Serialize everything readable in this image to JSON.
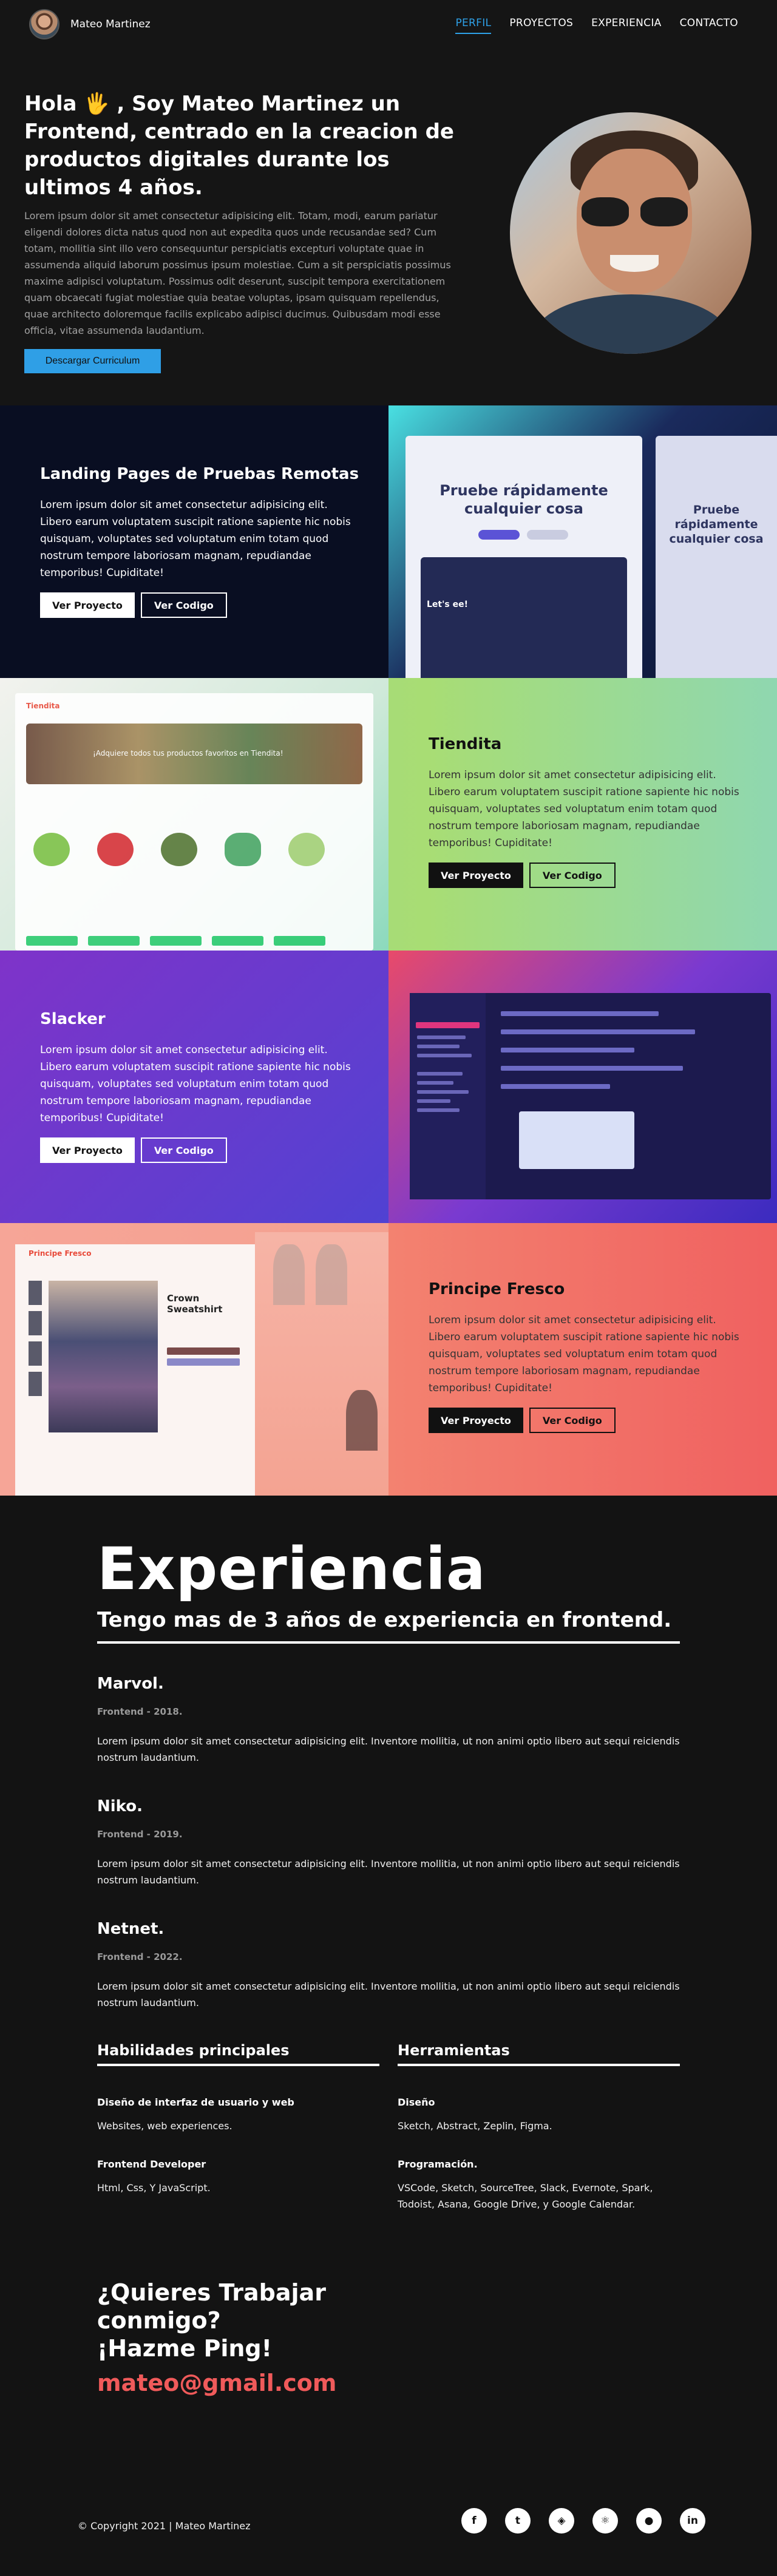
{
  "nav": {
    "brand_name": "Mateo Martinez",
    "links": [
      "PERFIL",
      "PROYECTOS",
      "EXPERIENCIA",
      "CONTACTO"
    ],
    "active": "PERFIL",
    "accent_color": "#2ea1e8"
  },
  "hero": {
    "title": "Hola 🖐 , Soy Mateo Martinez un Frontend, centrado en la creacion de productos digitales durante los ultimos 4 años.",
    "lead": "Lorem ipsum dolor sit amet consectetur adipisicing elit. Totam, modi, earum pariatur eligendi dolores dicta natus quod non aut expedita quos unde recusandae sed? Cum totam, mollitia sint illo vero consequuntur perspiciatis excepturi voluptate quae in assumenda aliquid laborum possimus ipsum molestiae. Cum a sit perspiciatis possimus maxime adipisci voluptatum. Possimus odit deserunt, suscipit tempora exercitationem quam obcaecati fugiat molestiae quia beatae voluptas, ipsam quisquam repellendus, quae architecto doloremque facilis explicabo adipisci ducimus. Quibusdam modi esse officia, vitae assumenda laudantium.",
    "cv_button": "Descargar Curriculum"
  },
  "projects": [
    {
      "title": "Landing Pages de Pruebas Remotas",
      "text": "Lorem ipsum dolor sit amet consectetur adipisicing elit. Libero earum voluptatem suscipit ratione sapiente hic nobis quisquam, voluptates sed voluptatum enim totam quod nostrum tempore laboriosam magnam, repudiandae temporibus! Cupiditate!",
      "btn_project": "Ver Proyecto",
      "btn_code": "Ver Codigo",
      "mock_heading": "Pruebe rápidamente cualquier cosa",
      "mock_sub": "Let's ee!"
    },
    {
      "title": "Tiendita",
      "text": "Lorem ipsum dolor sit amet consectetur adipisicing elit. Libero earum voluptatem suscipit ratione sapiente hic nobis quisquam, voluptates sed voluptatum enim totam quod nostrum tempore laboriosam magnam, repudiandae temporibus! Cupiditate!",
      "btn_project": "Ver Proyecto",
      "btn_code": "Ver Codigo",
      "mock_logo": "Tiendita",
      "mock_banner": "¡Adquiere todos tus productos favoritos en Tiendita!"
    },
    {
      "title": "Slacker",
      "text": "Lorem ipsum dolor sit amet consectetur adipisicing elit. Libero earum voluptatem suscipit ratione sapiente hic nobis quisquam, voluptates sed voluptatum enim totam quod nostrum tempore laboriosam magnam, repudiandae temporibus! Cupiditate!",
      "btn_project": "Ver Proyecto",
      "btn_code": "Ver Codigo"
    },
    {
      "title": "Principe Fresco",
      "text": "Lorem ipsum dolor sit amet consectetur adipisicing elit. Libero earum voluptatem suscipit ratione sapiente hic nobis quisquam, voluptates sed voluptatum enim totam quod nostrum tempore laboriosam magnam, repudiandae temporibus! Cupiditate!",
      "btn_project": "Ver Proyecto",
      "btn_code": "Ver Codigo",
      "mock_logo": "Principe Fresco",
      "mock_product": "Crown Sweatshirt"
    }
  ],
  "experience": {
    "heading": "Experiencia",
    "subheading": "Tengo mas de 3 años de experiencia en frontend.",
    "jobs": [
      {
        "company": "Marvol.",
        "role": "Frontend - 2018.",
        "text": "Lorem ipsum dolor sit amet consectetur adipisicing elit. Inventore mollitia, ut non animi optio libero aut sequi reiciendis nostrum laudantium."
      },
      {
        "company": "Niko.",
        "role": "Frontend - 2019.",
        "text": "Lorem ipsum dolor sit amet consectetur adipisicing elit. Inventore mollitia, ut non animi optio libero aut sequi reiciendis nostrum laudantium."
      },
      {
        "company": "Netnet.",
        "role": "Frontend - 2022.",
        "text": "Lorem ipsum dolor sit amet consectetur adipisicing elit. Inventore mollitia, ut non animi optio libero aut sequi reiciendis nostrum laudantium."
      }
    ],
    "skills": {
      "heading": "Habilidades principales",
      "items": [
        {
          "k": "Diseño de interfaz de usuario y web",
          "v": "Websites, web experiences."
        },
        {
          "k": "Frontend Developer",
          "v": "Html, Css, Y JavaScript."
        }
      ]
    },
    "tools": {
      "heading": "Herramientas",
      "items": [
        {
          "k": "Diseño",
          "v": "Sketch, Abstract, Zeplin, Figma."
        },
        {
          "k": "Programación.",
          "v": "VSCode, Sketch, SourceTree, Slack, Evernote, Spark, Todoist, Asana, Google Drive, y Google Calendar."
        }
      ]
    },
    "cta_line1": "¿Quieres Trabajar",
    "cta_line2": "conmigo?",
    "cta_line3": "¡Hazme Ping!",
    "email": "mateo@gmail.com",
    "email_color": "#f05a5a"
  },
  "footer": {
    "copyright": "© Copyright 2021 | Mateo Martinez",
    "socials": [
      {
        "name": "facebook-icon",
        "glyph": "f"
      },
      {
        "name": "twitter-icon",
        "glyph": "t"
      },
      {
        "name": "codepen-icon",
        "glyph": "◈"
      },
      {
        "name": "react-icon",
        "glyph": "⚛"
      },
      {
        "name": "github-icon",
        "glyph": "●"
      },
      {
        "name": "linkedin-icon",
        "glyph": "in"
      }
    ]
  }
}
